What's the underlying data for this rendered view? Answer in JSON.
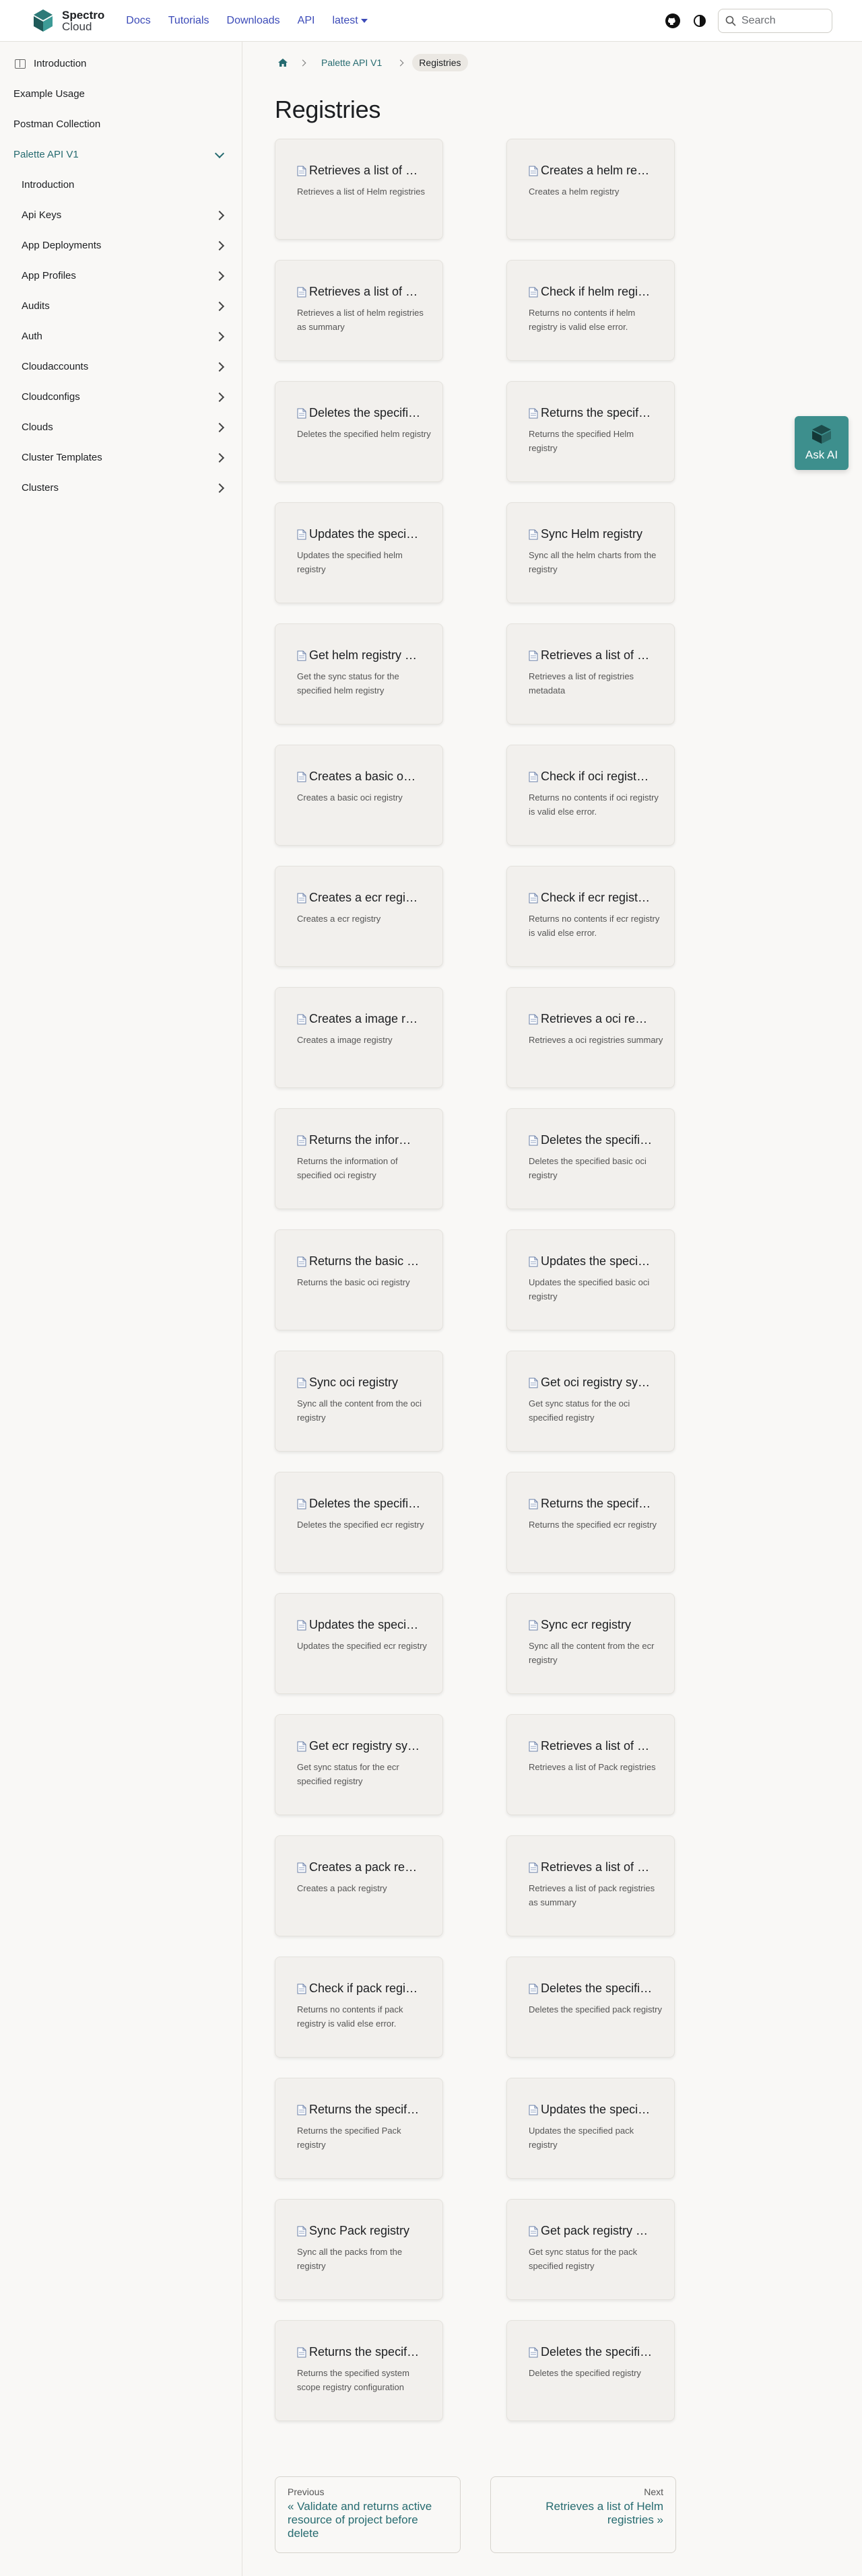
{
  "navbar": {
    "brand_line1": "Spectro",
    "brand_line2": "Cloud",
    "links": [
      "Docs",
      "Tutorials",
      "Downloads",
      "API"
    ],
    "version": "latest",
    "search_placeholder": "Search"
  },
  "sidebar": {
    "intro_top": "Introduction",
    "example_usage": "Example Usage",
    "postman": "Postman Collection",
    "palette_api": "Palette API V1",
    "children": [
      "Introduction",
      "Api Keys",
      "App Deployments",
      "App Profiles",
      "Audits",
      "Auth",
      "Cloudaccounts",
      "Cloudconfigs",
      "Clouds",
      "Cluster Templates",
      "Clusters"
    ]
  },
  "breadcrumbs": {
    "parent": "Palette API V1",
    "current": "Registries"
  },
  "page_title": "Registries",
  "cards": [
    {
      "title": "Retrieves a list of Helm registries",
      "desc": "Retrieves a list of Helm registries"
    },
    {
      "title": "Creates a helm registry",
      "desc": "Creates a helm registry"
    },
    {
      "title": "Retrieves a list of helm registries as summary",
      "desc": "Retrieves a list of helm registries as summary"
    },
    {
      "title": "Check if helm registry is valid",
      "desc": "Returns no contents if helm registry is valid else error."
    },
    {
      "title": "Deletes the specified helm registry",
      "desc": "Deletes the specified helm registry"
    },
    {
      "title": "Returns the specified Helm registry",
      "desc": "Returns the specified Helm registry"
    },
    {
      "title": "Updates the specified helm registry",
      "desc": "Updates the specified helm registry"
    },
    {
      "title": "Sync Helm registry",
      "desc": "Sync all the helm charts from the registry"
    },
    {
      "title": "Get helm registry sync status",
      "desc": "Get the sync status for the specified helm registry"
    },
    {
      "title": "Retrieves a list of registries metadata",
      "desc": "Retrieves a list of registries metadata"
    },
    {
      "title": "Creates a basic oci registry",
      "desc": "Creates a basic oci registry"
    },
    {
      "title": "Check if oci registry is valid",
      "desc": "Returns no contents if oci registry is valid else error."
    },
    {
      "title": "Creates a ecr registry",
      "desc": "Creates a ecr registry"
    },
    {
      "title": "Check if ecr registry is valid",
      "desc": "Returns no contents if ecr registry is valid else error."
    },
    {
      "title": "Creates a image registry",
      "desc": "Creates a image registry"
    },
    {
      "title": "Retrieves a oci registries summary",
      "desc": "Retrieves a oci registries summary"
    },
    {
      "title": "Returns the information of specified oci registry",
      "desc": "Returns the information of specified oci registry"
    },
    {
      "title": "Deletes the specified basic oci registry",
      "desc": "Deletes the specified basic oci registry"
    },
    {
      "title": "Returns the basic oci registry",
      "desc": "Returns the basic oci registry"
    },
    {
      "title": "Updates the specified basic oci registry",
      "desc": "Updates the specified basic oci registry"
    },
    {
      "title": "Sync oci registry",
      "desc": "Sync all the content from the oci registry"
    },
    {
      "title": "Get oci registry sync status",
      "desc": "Get sync status for the oci specified registry"
    },
    {
      "title": "Deletes the specified ecr registry",
      "desc": "Deletes the specified ecr registry"
    },
    {
      "title": "Returns the specified ecr registry",
      "desc": "Returns the specified ecr registry"
    },
    {
      "title": "Updates the specified ecr registry",
      "desc": "Updates the specified ecr registry"
    },
    {
      "title": "Sync ecr registry",
      "desc": "Sync all the content from the ecr registry"
    },
    {
      "title": "Get ecr registry sync status",
      "desc": "Get sync status for the ecr specified registry"
    },
    {
      "title": "Retrieves a list of Pack registries",
      "desc": "Retrieves a list of Pack registries"
    },
    {
      "title": "Creates a pack registry",
      "desc": "Creates a pack registry"
    },
    {
      "title": "Retrieves a list of pack registries as summary",
      "desc": "Retrieves a list of pack registries as summary"
    },
    {
      "title": "Check if pack registry is valid",
      "desc": "Returns no contents if pack registry is valid else error."
    },
    {
      "title": "Deletes the specified pack registry",
      "desc": "Deletes the specified pack registry"
    },
    {
      "title": "Returns the specified Pack registry",
      "desc": "Returns the specified Pack registry"
    },
    {
      "title": "Updates the specified pack registry",
      "desc": "Updates the specified pack registry"
    },
    {
      "title": "Sync Pack registry",
      "desc": "Sync all the packs from the registry"
    },
    {
      "title": "Get pack registry sync status",
      "desc": "Get sync status for the pack specified registry"
    },
    {
      "title": "Returns the specified system scope registry configuration",
      "desc": "Returns the specified system scope registry configuration"
    },
    {
      "title": "Deletes the specified registry",
      "desc": "Deletes the specified registry"
    }
  ],
  "pager": {
    "prev_label": "Previous",
    "prev_link": "« Validate and returns active resource of project before delete",
    "next_label": "Next",
    "next_link": "Retrieves a list of Helm registries »"
  },
  "ask_ai": "Ask AI",
  "colors": {
    "accent": "#266b70",
    "nav_link": "#3c4bb8",
    "ask_ai_bg": "#3d8f8d"
  }
}
